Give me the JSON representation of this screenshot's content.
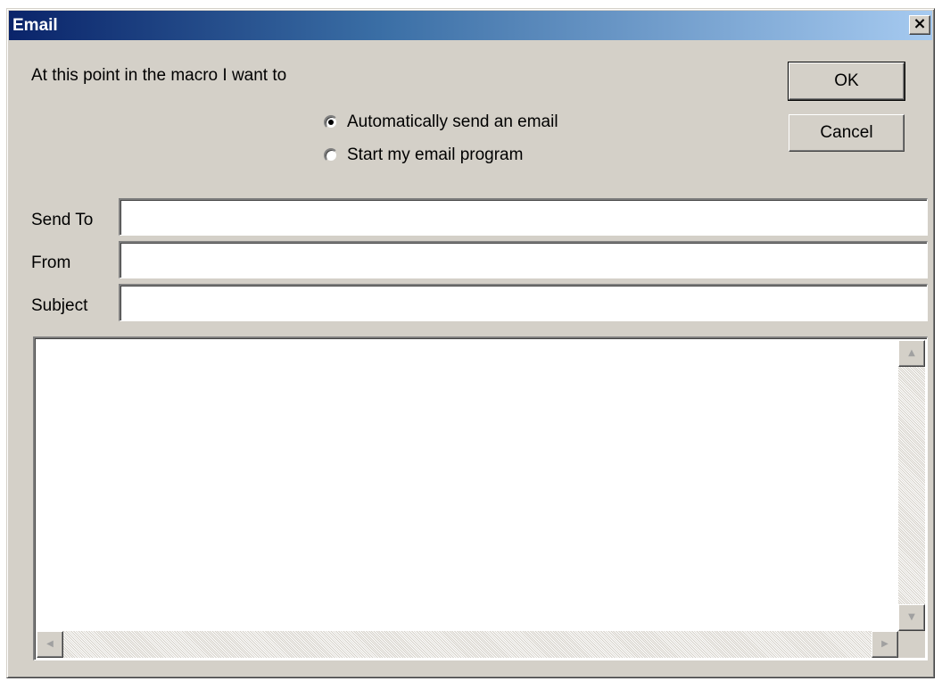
{
  "window": {
    "title": "Email",
    "close_glyph": "×"
  },
  "prompt": "At this point in the macro I want to",
  "buttons": {
    "ok_label": "OK",
    "cancel_label": "Cancel"
  },
  "options": [
    {
      "label": "Automatically send an email",
      "checked": true
    },
    {
      "label": "Start my email program",
      "checked": false
    }
  ],
  "fields": {
    "send_to": {
      "label": "Send To",
      "value": ""
    },
    "from": {
      "label": "From",
      "value": ""
    },
    "subject": {
      "label": "Subject",
      "value": ""
    }
  },
  "body": {
    "value": ""
  },
  "scrollbar": {
    "up_arrow": "▲",
    "down_arrow": "▼",
    "left_arrow": "◀",
    "right_arrow": "▶"
  },
  "colors": {
    "title_gradient_start": "#0a246a",
    "title_gradient_end": "#a6caf0",
    "face": "#d4d0c8"
  },
  "icons": [
    "close-icon",
    "radio-selected-icon",
    "radio-unselected-icon",
    "scroll-up-icon",
    "scroll-down-icon",
    "scroll-left-icon",
    "scroll-right-icon"
  ]
}
